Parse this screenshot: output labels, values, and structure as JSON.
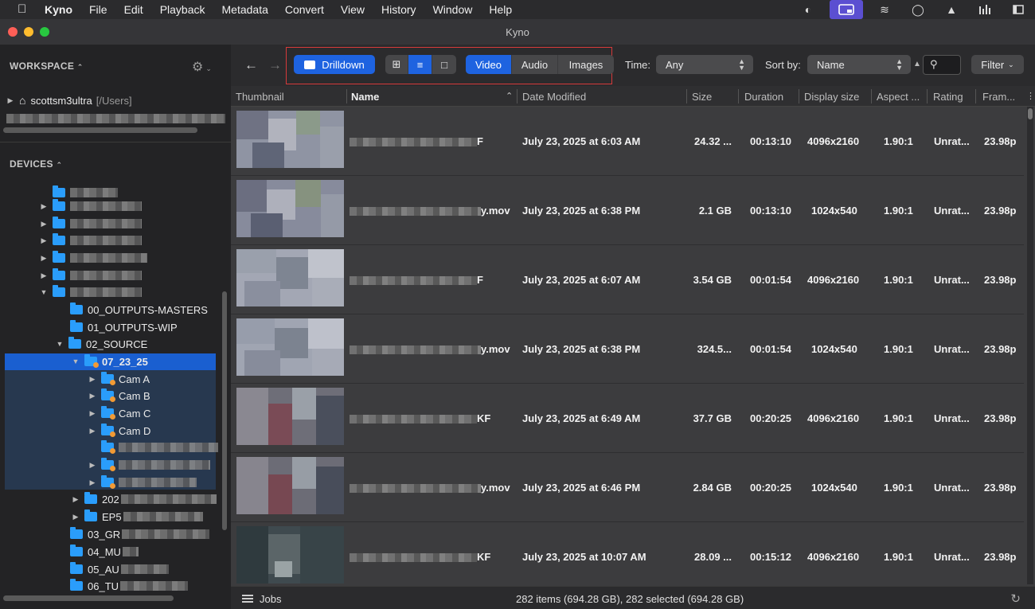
{
  "menubar": {
    "items": [
      "Kyno",
      "File",
      "Edit",
      "Playback",
      "Metadata",
      "Convert",
      "View",
      "History",
      "Window",
      "Help"
    ]
  },
  "window": {
    "title": "Kyno"
  },
  "sidebar": {
    "workspace_label": "WORKSPACE",
    "devices_label": "DEVICES",
    "home_name": "scottsm3ultra",
    "home_path": "[/Users]",
    "folders": {
      "outputs_masters": "00_OUTPUTS-MASTERS",
      "outputs_wip": "01_OUTPUTS-WIP",
      "source": "02_SOURCE",
      "date_folder": "07_23_25",
      "cam_a": "Cam A",
      "cam_b": "Cam B",
      "cam_c": "Cam C",
      "cam_d": "Cam D",
      "f202": "202",
      "fep": "EP5",
      "f03": "03_GR",
      "f04": "04_MU",
      "f05": "05_AU",
      "f06": "06_TU"
    }
  },
  "toolbar": {
    "drilldown": "Drilldown",
    "tabs": [
      "Video",
      "Audio",
      "Images"
    ],
    "active_tab": "Video",
    "time_label": "Time:",
    "time_value": "Any",
    "sort_label": "Sort by:",
    "sort_value": "Name",
    "filter_label": "Filter"
  },
  "table": {
    "columns": [
      "Thumbnail",
      "Name",
      "Date Modified",
      "Size",
      "Duration",
      "Display size",
      "Aspect ...",
      "Rating",
      "Fram..."
    ],
    "rows": [
      {
        "name_suffix": "F",
        "date": "July 23, 2025 at 6:03 AM",
        "size": "24.32 ...",
        "duration": "00:13:10",
        "display": "4096x2160",
        "aspect": "1.90:1",
        "rating": "Unrat...",
        "fps": "23.98p"
      },
      {
        "name_suffix": "y.mov",
        "date": "July 23, 2025 at 6:38 PM",
        "size": "2.1 GB",
        "duration": "00:13:10",
        "display": "1024x540",
        "aspect": "1.90:1",
        "rating": "Unrat...",
        "fps": "23.98p"
      },
      {
        "name_suffix": "F",
        "date": "July 23, 2025 at 6:07 AM",
        "size": "3.54 GB",
        "duration": "00:01:54",
        "display": "4096x2160",
        "aspect": "1.90:1",
        "rating": "Unrat...",
        "fps": "23.98p"
      },
      {
        "name_suffix": "y.mov",
        "date": "July 23, 2025 at 6:38 PM",
        "size": "324.5...",
        "duration": "00:01:54",
        "display": "1024x540",
        "aspect": "1.90:1",
        "rating": "Unrat...",
        "fps": "23.98p"
      },
      {
        "name_suffix": "KF",
        "date": "July 23, 2025 at 6:49 AM",
        "size": "37.7 GB",
        "duration": "00:20:25",
        "display": "4096x2160",
        "aspect": "1.90:1",
        "rating": "Unrat...",
        "fps": "23.98p"
      },
      {
        "name_suffix": "y.mov",
        "date": "July 23, 2025 at 6:46 PM",
        "size": "2.84 GB",
        "duration": "00:20:25",
        "display": "1024x540",
        "aspect": "1.90:1",
        "rating": "Unrat...",
        "fps": "23.98p"
      },
      {
        "name_suffix": "KF",
        "date": "July 23, 2025 at 10:07 AM",
        "size": "28.09 ...",
        "duration": "00:15:12",
        "display": "4096x2160",
        "aspect": "1.90:1",
        "rating": "Unrat...",
        "fps": "23.98p"
      }
    ]
  },
  "footer": {
    "jobs_label": "Jobs",
    "summary": "282 items (694.28 GB), 282 selected (694.28 GB)"
  },
  "colors": {
    "accent": "#1e63e0",
    "highlight_box": "#d63a3a",
    "folder": "#2a9dfb"
  }
}
